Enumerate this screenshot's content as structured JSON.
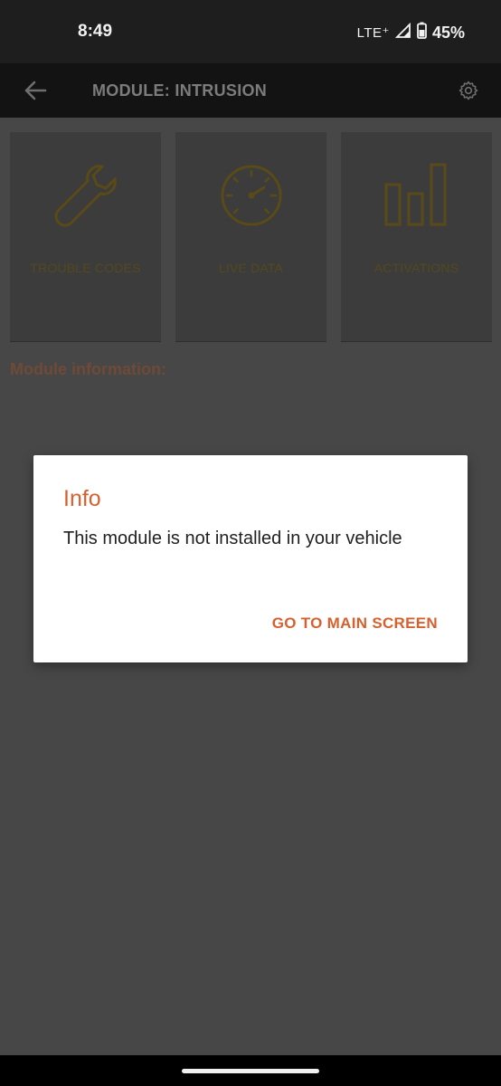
{
  "status_bar": {
    "time": "8:49",
    "network": "LTE⁺",
    "battery": "45%"
  },
  "app_bar": {
    "title": "MODULE: INTRUSION",
    "back_icon": "arrow-left-icon",
    "settings_icon": "gear-icon"
  },
  "tiles": [
    {
      "label": "TROUBLE CODES",
      "icon": "wrench-icon"
    },
    {
      "label": "LIVE DATA",
      "icon": "speedometer-icon"
    },
    {
      "label": "ACTIVATIONS",
      "icon": "bar-chart-icon"
    }
  ],
  "module_info": {
    "label": "Module information:"
  },
  "dialog": {
    "title": "Info",
    "message": "This module is not installed in your vehicle",
    "action_label": "GO TO MAIN SCREEN"
  },
  "colors": {
    "accent": "#d8602f",
    "tile_icon": "#5a4a17",
    "background": "#474747",
    "app_bar": "#131313",
    "status_bar": "#1e1e1e"
  }
}
